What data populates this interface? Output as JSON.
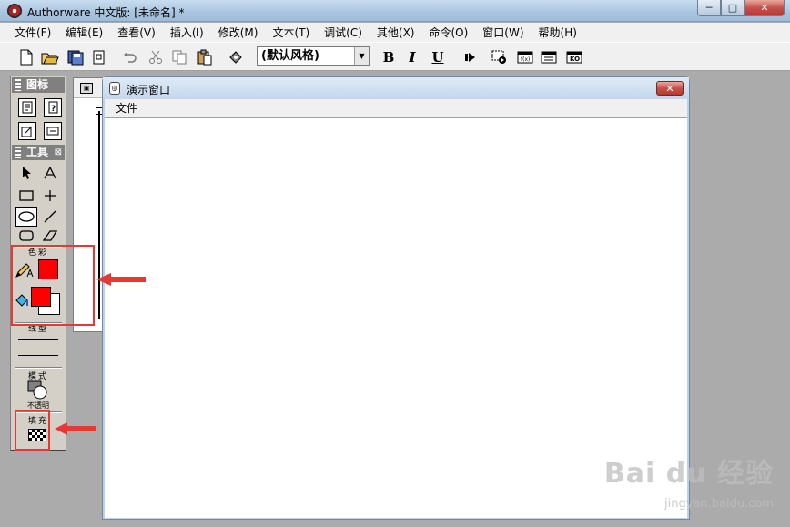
{
  "window": {
    "title": "Authorware 中文版: [未命名] *",
    "minimize_glyph": "─",
    "maximize_glyph": "□",
    "close_glyph": "✕"
  },
  "menu": [
    "文件(F)",
    "编辑(E)",
    "查看(V)",
    "插入(I)",
    "修改(M)",
    "文本(T)",
    "调试(C)",
    "其他(X)",
    "命令(O)",
    "窗口(W)",
    "帮助(H)"
  ],
  "toolbar": {
    "style_value": "(默认风格)",
    "bold_label": "B",
    "italic_label": "I",
    "underline_label": "U"
  },
  "icons_palette": {
    "title": "图标"
  },
  "tools_palette": {
    "title": "工具",
    "color_label": "色彩",
    "line_label": "线型",
    "mode_label": "模式",
    "mode_value": "不透明",
    "fill_label": "填充",
    "line_color": "#ff0000",
    "fill_foreground": "#ff0000",
    "fill_background": "#ffffff"
  },
  "presentation": {
    "title": "演示窗口",
    "menu_file": "文件"
  },
  "colors": {
    "annotation_red": "#e53935"
  },
  "watermark": {
    "brand": "Bai du 经验",
    "url": "jingyan.baidu.com"
  }
}
